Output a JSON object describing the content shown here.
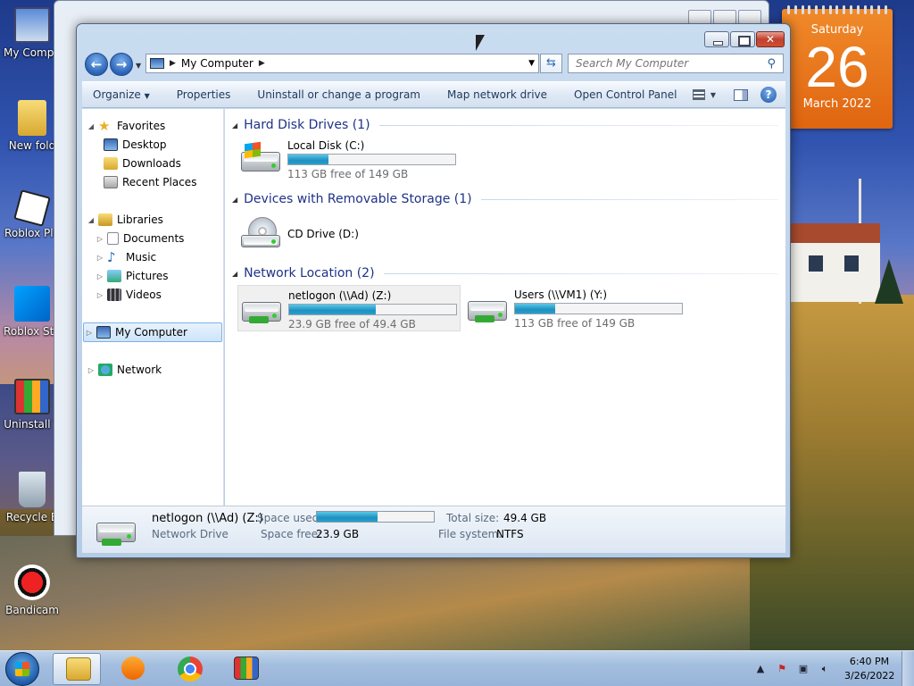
{
  "desktop": {
    "icons": [
      {
        "label": "My Compu",
        "icon": "computer-icon"
      },
      {
        "label": "New fold",
        "icon": "folder-icon"
      },
      {
        "label": "Roblox Pla",
        "icon": "roblox-icon"
      },
      {
        "label": "Roblox Stu",
        "icon": "roblox-studio-icon"
      },
      {
        "label": "Uninstall T",
        "icon": "uninstall-tool-icon"
      },
      {
        "label": "Recycle B",
        "icon": "recycle-bin-icon"
      },
      {
        "label": "Bandicam",
        "icon": "bandicam-icon"
      }
    ]
  },
  "calendar": {
    "weekday": "Saturday",
    "day": "26",
    "month_year": "March 2022"
  },
  "window": {
    "address": {
      "crumb": "My Computer"
    },
    "search": {
      "placeholder": "Search My Computer"
    },
    "toolbar": {
      "organize": "Organize",
      "properties": "Properties",
      "uninstall": "Uninstall or change a program",
      "map_drive": "Map network drive",
      "control_panel": "Open Control Panel"
    },
    "nav": {
      "favorites": "Favorites",
      "desktop": "Desktop",
      "downloads": "Downloads",
      "recent": "Recent Places",
      "libraries": "Libraries",
      "documents": "Documents",
      "music": "Music",
      "pictures": "Pictures",
      "videos": "Videos",
      "my_computer": "My Computer",
      "network": "Network"
    },
    "groups": {
      "hdd": "Hard Disk Drives (1)",
      "removable": "Devices with Removable Storage (1)",
      "network": "Network Location (2)"
    },
    "drives": {
      "c": {
        "name": "Local Disk (C:)",
        "free": "113 GB free of 149 GB",
        "used_fraction": 0.24
      },
      "d": {
        "name": "CD Drive (D:)"
      },
      "z": {
        "name": "netlogon (\\\\Ad) (Z:)",
        "free": "23.9 GB free of 49.4 GB",
        "used_fraction": 0.52
      },
      "y": {
        "name": "Users (\\\\VM1) (Y:)",
        "free": "113 GB free of 149 GB",
        "used_fraction": 0.24
      }
    },
    "details": {
      "name": "netlogon (\\\\Ad) (Z:)",
      "type": "Network Drive",
      "space_used_label": "Space used:",
      "space_free_label": "Space free:",
      "space_free": "23.9 GB",
      "total_label": "Total size:",
      "total": "49.4 GB",
      "fs_label": "File system:",
      "fs": "NTFS",
      "used_fraction": 0.52
    }
  },
  "taskbar": {
    "clock_time": "6:40 PM",
    "clock_date": "3/26/2022"
  },
  "colors": {
    "accent": "#1e3287",
    "bar_fill": "#1f90c0",
    "calendar": "#e87018"
  }
}
